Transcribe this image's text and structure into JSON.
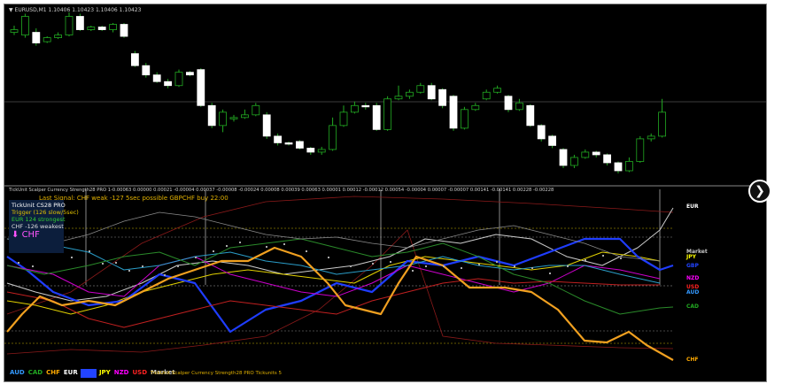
{
  "window": {
    "main_title": "▼ EURUSD,M1  1.10406 1.10423 1.10406 1.10423",
    "indicator_title": "TickUnit Scalper Currency Strength28 PRO 1-0.00063 0.00000 0.00021 -0.00004 0.00037 -0.00008 -0.00024 0.00008 0.00039 0.00063 0.00001 0.00012 -0.00012 0.00054 -0.00004 0.00007 -0.00007 0.00141 -0.00141 0.00228 -0.00228"
  },
  "signal": {
    "last_signal": "Last Signal: CHF weak -127 5sec possible GBPCHF buy 22:00"
  },
  "info_panel": {
    "line1": "TickUnit CS28 PRO",
    "line2": "Trigger (126 slow/5sec)",
    "line3": "EUR 124 strongest",
    "line4": "CHF -126 weakest",
    "arrow": "⬇",
    "weak_currency": "CHF",
    "colors": {
      "line1": "#ffffff",
      "line2": "#e0c000",
      "line3": "#33cc33",
      "line4": "#e0e0e0",
      "weak": "#ff55ff"
    }
  },
  "right_labels": [
    {
      "text": "EUR",
      "color": "#ffffff"
    },
    {
      "text": "Market",
      "color": "#c8c8c8"
    },
    {
      "text": "JPY",
      "color": "#ffff00"
    },
    {
      "text": "GBP",
      "color": "#2244ff"
    },
    {
      "text": "NZD",
      "color": "#ff00ff"
    },
    {
      "text": "USD",
      "color": "#ff2222"
    },
    {
      "text": "AUD",
      "color": "#3399ff"
    },
    {
      "text": "CAD",
      "color": "#22aa22"
    },
    {
      "text": "CHF",
      "color": "#ffaa00"
    }
  ],
  "legend": [
    {
      "text": "AUD",
      "color": "#3399ff",
      "bg": "#000000"
    },
    {
      "text": "CAD",
      "color": "#22aa22",
      "bg": "#000000"
    },
    {
      "text": "CHF",
      "color": "#ffaa00",
      "bg": "#000000"
    },
    {
      "text": "EUR",
      "color": "#ffffff",
      "bg": "#000000"
    },
    {
      "text": "GBP",
      "color": "#2244ff",
      "bg": "#2244ff"
    },
    {
      "text": "JPY",
      "color": "#ffff00",
      "bg": "#000000"
    },
    {
      "text": "NZD",
      "color": "#ff00ff",
      "bg": "#000000"
    },
    {
      "text": "USD",
      "color": "#ff2222",
      "bg": "#000000"
    },
    {
      "text": "Market",
      "color": "#c8c8c8",
      "bg": "#000000"
    }
  ],
  "bottom_note": "TickUnit Scalper Currency Strength28 PRO  Tickunits 5",
  "nav_icon": "chevron-right-icon",
  "chart_data": {
    "type": "candlestick",
    "candles": [
      {
        "o": 1.104,
        "c": 1.10402,
        "h": 1.10405,
        "l": 1.10398
      },
      {
        "o": 1.10398,
        "c": 1.10412,
        "h": 1.10414,
        "l": 1.10396
      },
      {
        "o": 1.104,
        "c": 1.10392,
        "h": 1.10403,
        "l": 1.1039
      },
      {
        "o": 1.10393,
        "c": 1.10396,
        "h": 1.10397,
        "l": 1.10392
      },
      {
        "o": 1.10396,
        "c": 1.10398,
        "h": 1.104,
        "l": 1.10395
      },
      {
        "o": 1.10398,
        "c": 1.10412,
        "h": 1.10415,
        "l": 1.10397
      },
      {
        "o": 1.10412,
        "c": 1.10402,
        "h": 1.10414,
        "l": 1.10401
      },
      {
        "o": 1.10402,
        "c": 1.10404,
        "h": 1.10405,
        "l": 1.10401
      },
      {
        "o": 1.10404,
        "c": 1.10402,
        "h": 1.10405,
        "l": 1.10401
      },
      {
        "o": 1.10402,
        "c": 1.10406,
        "h": 1.10407,
        "l": 1.104
      },
      {
        "o": 1.10406,
        "c": 1.10397,
        "h": 1.10407,
        "l": 1.10396
      },
      {
        "o": 1.10384,
        "c": 1.10375,
        "h": 1.10386,
        "l": 1.10374
      },
      {
        "o": 1.10375,
        "c": 1.10368,
        "h": 1.10377,
        "l": 1.10366
      },
      {
        "o": 1.10368,
        "c": 1.10363,
        "h": 1.1037,
        "l": 1.10362
      },
      {
        "o": 1.10363,
        "c": 1.1036,
        "h": 1.10365,
        "l": 1.10358
      },
      {
        "o": 1.1036,
        "c": 1.1037,
        "h": 1.10372,
        "l": 1.10359
      },
      {
        "o": 1.1037,
        "c": 1.10368,
        "h": 1.10371,
        "l": 1.10367
      },
      {
        "o": 1.10372,
        "c": 1.10345,
        "h": 1.10373,
        "l": 1.10344
      },
      {
        "o": 1.10345,
        "c": 1.1033,
        "h": 1.10347,
        "l": 1.10328
      },
      {
        "o": 1.1033,
        "c": 1.1034,
        "h": 1.10342,
        "l": 1.10325
      },
      {
        "o": 1.10335,
        "c": 1.10336,
        "h": 1.10338,
        "l": 1.10333
      },
      {
        "o": 1.10336,
        "c": 1.10338,
        "h": 1.10342,
        "l": 1.10335
      },
      {
        "o": 1.10338,
        "c": 1.10345,
        "h": 1.10347,
        "l": 1.10337
      },
      {
        "o": 1.10338,
        "c": 1.10322,
        "h": 1.1034,
        "l": 1.1032
      },
      {
        "o": 1.10322,
        "c": 1.10317,
        "h": 1.10324,
        "l": 1.10315
      },
      {
        "o": 1.10317,
        "c": 1.10316,
        "h": 1.10318,
        "l": 1.10315
      },
      {
        "o": 1.10318,
        "c": 1.10313,
        "h": 1.10319,
        "l": 1.10312
      },
      {
        "o": 1.10313,
        "c": 1.1031,
        "h": 1.10314,
        "l": 1.10308
      },
      {
        "o": 1.1031,
        "c": 1.10312,
        "h": 1.10314,
        "l": 1.10308
      },
      {
        "o": 1.10312,
        "c": 1.1033,
        "h": 1.10336,
        "l": 1.10311
      },
      {
        "o": 1.1033,
        "c": 1.1034,
        "h": 1.10345,
        "l": 1.10329
      },
      {
        "o": 1.1034,
        "c": 1.10345,
        "h": 1.10348,
        "l": 1.10339
      },
      {
        "o": 1.10345,
        "c": 1.10344,
        "h": 1.10347,
        "l": 1.10342
      },
      {
        "o": 1.10345,
        "c": 1.10327,
        "h": 1.10347,
        "l": 1.10326
      },
      {
        "o": 1.10327,
        "c": 1.1035,
        "h": 1.10352,
        "l": 1.10326
      },
      {
        "o": 1.1035,
        "c": 1.10352,
        "h": 1.1036,
        "l": 1.10349
      },
      {
        "o": 1.10352,
        "c": 1.10355,
        "h": 1.10357,
        "l": 1.1035
      },
      {
        "o": 1.10355,
        "c": 1.1036,
        "h": 1.10362,
        "l": 1.10354
      },
      {
        "o": 1.1036,
        "c": 1.1035,
        "h": 1.10362,
        "l": 1.10349
      },
      {
        "o": 1.10357,
        "c": 1.10345,
        "h": 1.10358,
        "l": 1.10343
      },
      {
        "o": 1.10352,
        "c": 1.10328,
        "h": 1.10353,
        "l": 1.10326
      },
      {
        "o": 1.10328,
        "c": 1.10342,
        "h": 1.10344,
        "l": 1.10327
      },
      {
        "o": 1.10342,
        "c": 1.10345,
        "h": 1.10347,
        "l": 1.10341
      },
      {
        "o": 1.1035,
        "c": 1.10355,
        "h": 1.10357,
        "l": 1.10349
      },
      {
        "o": 1.10355,
        "c": 1.10358,
        "h": 1.1036,
        "l": 1.10354
      },
      {
        "o": 1.10352,
        "c": 1.10342,
        "h": 1.10353,
        "l": 1.1034
      },
      {
        "o": 1.10342,
        "c": 1.10347,
        "h": 1.1035,
        "l": 1.10341
      },
      {
        "o": 1.10345,
        "c": 1.1033,
        "h": 1.10346,
        "l": 1.10329
      },
      {
        "o": 1.1033,
        "c": 1.1032,
        "h": 1.10331,
        "l": 1.10318
      },
      {
        "o": 1.10322,
        "c": 1.10315,
        "h": 1.10323,
        "l": 1.10313
      },
      {
        "o": 1.10312,
        "c": 1.103,
        "h": 1.10313,
        "l": 1.10298
      },
      {
        "o": 1.103,
        "c": 1.10306,
        "h": 1.10308,
        "l": 1.10298
      },
      {
        "o": 1.10306,
        "c": 1.1031,
        "h": 1.10312,
        "l": 1.10305
      },
      {
        "o": 1.1031,
        "c": 1.10308,
        "h": 1.10311,
        "l": 1.10306
      },
      {
        "o": 1.10308,
        "c": 1.10302,
        "h": 1.10309,
        "l": 1.103
      },
      {
        "o": 1.10302,
        "c": 1.10296,
        "h": 1.10303,
        "l": 1.10294
      },
      {
        "o": 1.10296,
        "c": 1.10303,
        "h": 1.10306,
        "l": 1.10295
      },
      {
        "o": 1.10303,
        "c": 1.1032,
        "h": 1.10322,
        "l": 1.10302
      },
      {
        "o": 1.1032,
        "c": 1.10322,
        "h": 1.10324,
        "l": 1.10318
      },
      {
        "o": 1.10322,
        "c": 1.1034,
        "h": 1.1035,
        "l": 1.10321
      }
    ]
  }
}
